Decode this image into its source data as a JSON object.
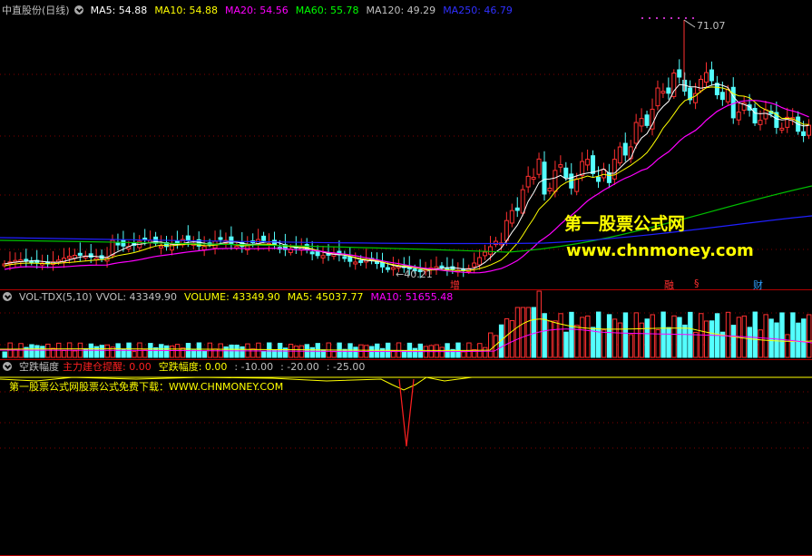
{
  "main_panel": {
    "title": "中直股份(日线)",
    "indicators": [
      {
        "label": "MA5: 54.88",
        "color": "#ffffff"
      },
      {
        "label": "MA10: 54.88",
        "color": "#ffff00"
      },
      {
        "label": "MA20: 54.56",
        "color": "#ff00ff"
      },
      {
        "label": "MA60: 55.78",
        "color": "#00ff00"
      },
      {
        "label": "MA120: 49.29",
        "color": "#c0c0c0"
      },
      {
        "label": "MA250: 46.79",
        "color": "#3030ff"
      }
    ],
    "high_label": "71.07",
    "low_label": "←40.21",
    "markers": [
      {
        "label": "增",
        "color": "#ff3030"
      },
      {
        "label": "融",
        "color": "#ff3030"
      },
      {
        "label": "§",
        "color": "#ff3030"
      },
      {
        "label": "财",
        "color": "#30a0ff"
      }
    ]
  },
  "watermark": {
    "line1": "第一股票公式网",
    "line2": "www.chnmoney.com"
  },
  "volume_panel": {
    "title": "VOL-TDX(5,10)",
    "values": [
      {
        "label": "VVOL: 43349.90",
        "color": "#c0c0c0"
      },
      {
        "label": "VOLUME: 43349.90",
        "color": "#ffff00"
      },
      {
        "label": "MA5: 45037.77",
        "color": "#ffff00"
      },
      {
        "label": "MA10: 51655.48",
        "color": "#ff00ff"
      }
    ]
  },
  "indicator_panel": {
    "title": "空跌幅度",
    "values": [
      {
        "label": "主力建仓提醒: 0.00",
        "color": "#ff2020"
      },
      {
        "label": "空跌幅度: 0.00",
        "color": "#ffff00"
      },
      {
        "label": ": -10.00",
        "color": "#c0c0c0"
      },
      {
        "label": ": -20.00",
        "color": "#c0c0c0"
      },
      {
        "label": ": -25.00",
        "color": "#c0c0c0"
      }
    ],
    "note": "第一股票公式网股票公式免费下载：WWW.CHNMONEY.COM"
  }
}
